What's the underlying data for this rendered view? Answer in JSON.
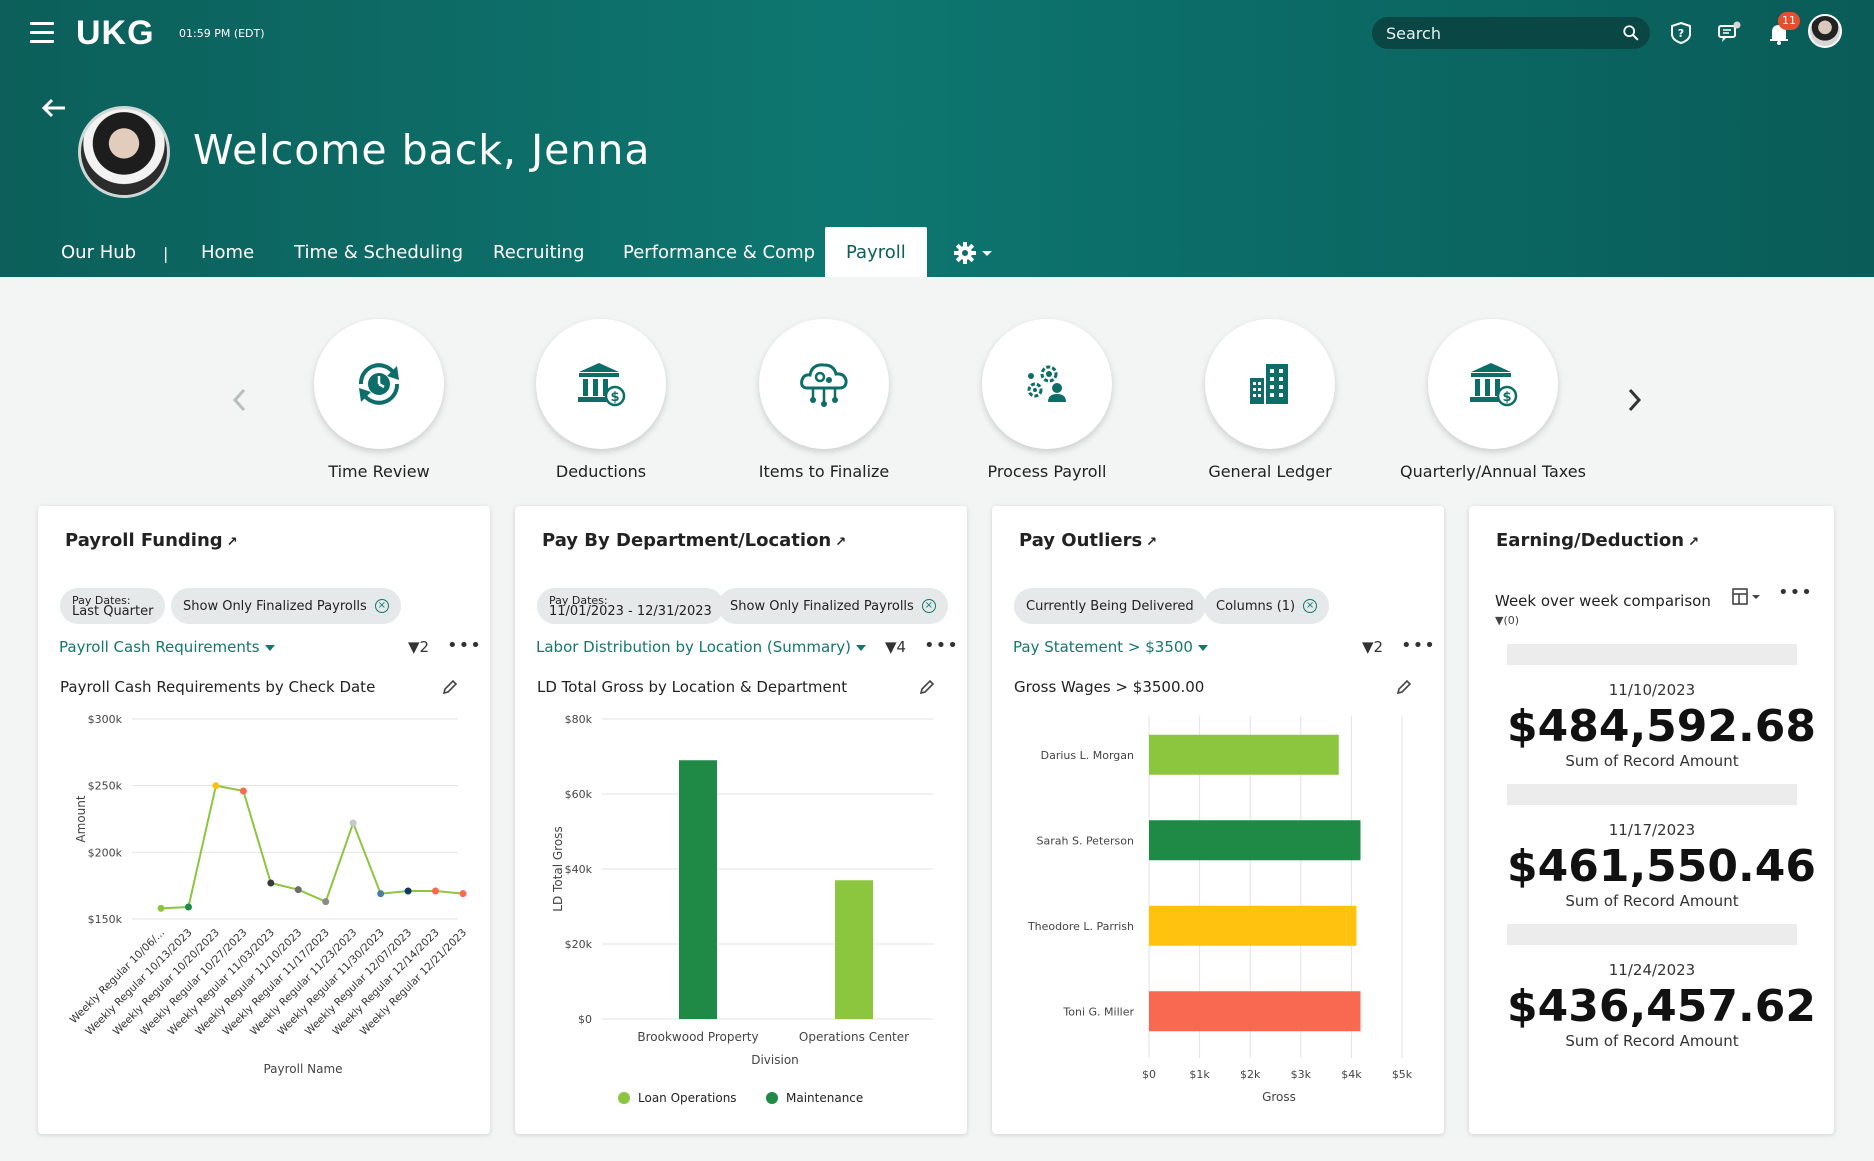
{
  "header": {
    "logo": "UKG",
    "time": "01:59 PM (EDT)",
    "search_placeholder": "Search",
    "notification_count": "11",
    "welcome": "Welcome back, Jenna"
  },
  "nav": {
    "hub": "Our Hub",
    "separator": "|",
    "items": [
      "Home",
      "Time & Scheduling",
      "Recruiting",
      "Performance & Comp",
      "Payroll"
    ],
    "active": "Payroll"
  },
  "quick_links": [
    "Time Review",
    "Deductions",
    "Items to Finalize",
    "Process Payroll",
    "General Ledger",
    "Quarterly/Annual Taxes"
  ],
  "colors": {
    "brand": "#0b6a65",
    "accent": "#13776f",
    "light_green": "#8cc63f",
    "dark_green": "#1f8a45",
    "yellow": "#ffc20e",
    "red": "#f96850"
  },
  "cards": {
    "payroll_funding": {
      "title": "Payroll Funding",
      "chip1_key": "Pay Dates:",
      "chip1_val": "Last Quarter",
      "chip2": "Show Only Finalized Payrolls",
      "select": "Payroll Cash Requirements",
      "filters": "2",
      "chart_title": "Payroll Cash Requirements by Check Date"
    },
    "pay_by_dept": {
      "title": "Pay By Department/Location",
      "chip1_key": "Pay Dates:",
      "chip1_val": "11/01/2023 - 12/31/2023",
      "chip2": "Show Only Finalized Payrolls",
      "select": "Labor Distribution by Location (Summary)",
      "filters": "4",
      "chart_title": "LD Total Gross by Location & Department"
    },
    "pay_outliers": {
      "title": "Pay Outliers",
      "chip1": "Currently Being Delivered",
      "chip2": "Columns (1)",
      "select": "Pay Statement > $3500",
      "filters": "2",
      "chart_title": "Gross Wages > $3500.00"
    },
    "earning_deduction": {
      "title": "Earning/Deduction",
      "subtitle": "Week over week comparison",
      "filter": "(0)",
      "blocks": [
        {
          "date": "11/10/2023",
          "amount": "$484,592.68",
          "caption": "Sum of Record Amount"
        },
        {
          "date": "11/17/2023",
          "amount": "$461,550.46",
          "caption": "Sum of Record Amount"
        },
        {
          "date": "11/24/2023",
          "amount": "$436,457.62",
          "caption": "Sum of Record Amount"
        }
      ]
    }
  },
  "chart_data": [
    {
      "type": "line",
      "title": "Payroll Cash Requirements by Check Date",
      "xlabel": "Payroll Name",
      "ylabel": "Amount",
      "ylim": [
        150000,
        300000
      ],
      "yticks": [
        "$150k",
        "$200k",
        "$250k",
        "$300k"
      ],
      "categories": [
        "Weekly Regular 10/06/...",
        "Weekly Regular 10/13/2023",
        "Weekly Regular 10/20/2023",
        "Weekly Regular 10/27/2023",
        "Weekly Regular 11/03/2023",
        "Weekly Regular 11/10/2023",
        "Weekly Regular 11/17/2023",
        "Weekly Regular 11/23/2023",
        "Weekly Regular 11/30/2023",
        "Weekly Regular 12/07/2023",
        "Weekly Regular 12/14/2023",
        "Weekly Regular 12/21/2023"
      ],
      "values": [
        158000,
        159000,
        250000,
        246000,
        177000,
        172000,
        163000,
        222000,
        169000,
        171000,
        171000,
        169000
      ],
      "point_colors": [
        "#8cc63f",
        "#1f8a45",
        "#ffc20e",
        "#f96850",
        "#3a3a3a",
        "#6b6b6b",
        "#8a8a8a",
        "#c8c8c8",
        "#4a7fa0",
        "#0d3b66",
        "#f96850",
        "#f96850"
      ],
      "grid": true
    },
    {
      "type": "bar",
      "title": "LD Total Gross by Location & Department",
      "xlabel": "Division",
      "ylabel": "LD Total Gross",
      "ylim": [
        0,
        80000
      ],
      "yticks": [
        "$0",
        "$20k",
        "$40k",
        "$60k",
        "$80k"
      ],
      "categories": [
        "Brookwood Property",
        "Operations Center"
      ],
      "series": [
        {
          "name": "Maintenance",
          "values": [
            69000,
            0
          ],
          "color": "#1f8a45"
        },
        {
          "name": "Loan Operations",
          "values": [
            0,
            37000
          ],
          "color": "#8cc63f"
        }
      ],
      "legend": [
        "Loan Operations",
        "Maintenance"
      ],
      "legend_position": "bottom",
      "grid": true
    },
    {
      "type": "bar",
      "orientation": "horizontal",
      "title": "Gross Wages > $3500.00",
      "xlabel": "Gross",
      "xlim": [
        0,
        5000
      ],
      "xticks": [
        "$0",
        "$1k",
        "$2k",
        "$3k",
        "$4k",
        "$5k"
      ],
      "categories": [
        "Darius L. Morgan",
        "Sarah S. Peterson",
        "Theodore L. Parrish",
        "Toni G. Miller"
      ],
      "values": [
        3750,
        4180,
        4100,
        4180
      ],
      "colors": [
        "#8cc63f",
        "#1f8a45",
        "#ffc20e",
        "#f96850"
      ],
      "grid": true
    }
  ]
}
